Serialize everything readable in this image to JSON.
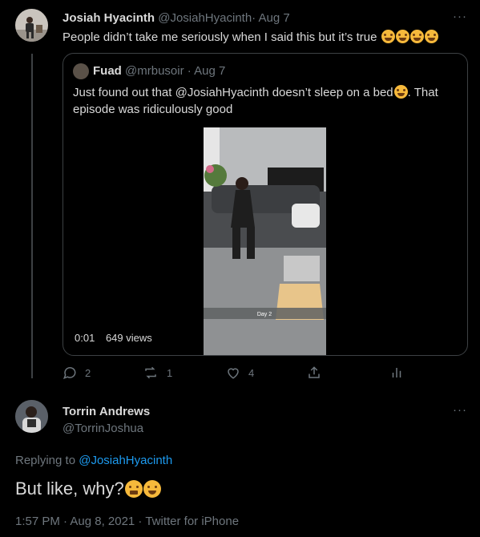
{
  "tweet1": {
    "display_name": "Josiah Hyacinth",
    "handle": "@JosiahHyacinth",
    "separator": "·",
    "date": "Aug 7",
    "text": "People didn’t take me seriously when I said this but it’s true",
    "more_icon": "more-horizontal-icon",
    "quote": {
      "display_name": "Fuad",
      "handle": "@mrbusoir",
      "separator": "·",
      "date": "Aug 7",
      "text_part1": "Just found out that @JosiahHyacinth doesn’t sleep on a bed",
      "text_part2": ". That episode was ridiculously good",
      "video": {
        "elapsed": "0:01",
        "views": "649 views",
        "caption": "Day 2"
      }
    },
    "actions": {
      "reply_count": "2",
      "retweet_count": "1",
      "like_count": "4",
      "share_label": "",
      "analytics_label": ""
    }
  },
  "tweet2": {
    "display_name": "Torrin Andrews",
    "handle": "@TorrinJoshua",
    "replying_prefix": "Replying to",
    "replying_to": "@JosiahHyacinth",
    "text": "But like, why?",
    "timestamp": "1:57 PM · Aug 8, 2021 · Twitter for iPhone"
  },
  "colors": {
    "background": "#000000",
    "text": "#d9d9d9",
    "muted": "#6e767d",
    "link": "#1d9bf0",
    "border": "#3d4144"
  }
}
